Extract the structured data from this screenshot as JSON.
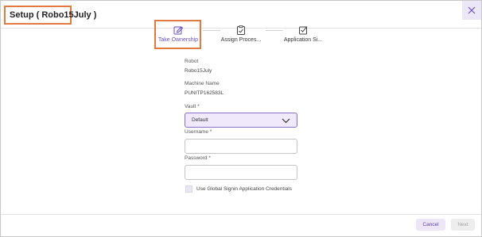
{
  "dialog": {
    "title": "Setup ( Robo15July )",
    "close_icon": "close-icon",
    "accent_color": "#8b6fd0",
    "highlight_color": "#e07a3f"
  },
  "steps": [
    {
      "label": "Take Ownership",
      "icon": "edit-icon",
      "active": true
    },
    {
      "label": "Assign Proces...",
      "icon": "clipboard-check-icon",
      "active": false
    },
    {
      "label": "Application Si...",
      "icon": "checkbox-icon",
      "active": false
    }
  ],
  "form": {
    "robot_label": "Robot",
    "robot_value": "Robo15July",
    "machine_label": "Machine Name",
    "machine_value": "PUNITP162583L",
    "vault_label": "Vault *",
    "vault_value": "Default",
    "username_label": "Username *",
    "username_value": "",
    "password_label": "Password *",
    "password_value": "",
    "checkbox_label": "Use Global Signin Application Credentials"
  },
  "footer": {
    "cancel_label": "Cancel",
    "next_label": "Next"
  }
}
